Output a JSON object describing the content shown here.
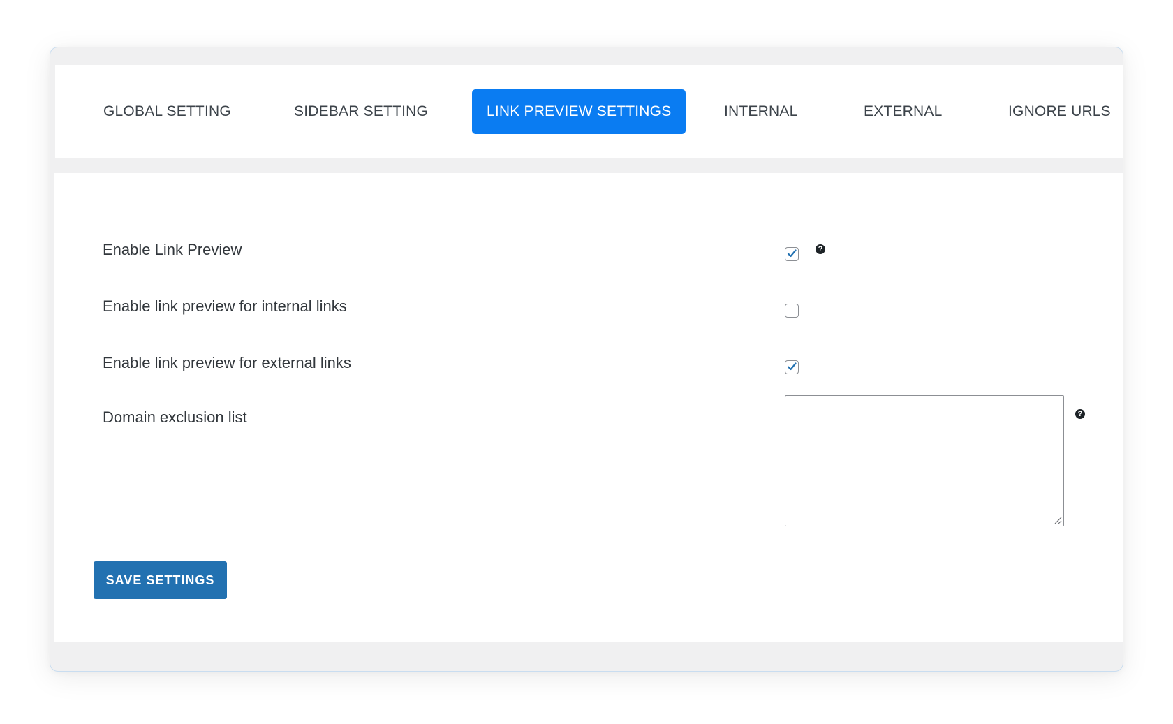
{
  "tabs": [
    {
      "label": "GLOBAL SETTING",
      "active": false
    },
    {
      "label": "SIDEBAR SETTING",
      "active": false
    },
    {
      "label": "LINK PREVIEW SETTINGS",
      "active": true
    },
    {
      "label": "INTERNAL",
      "active": false
    },
    {
      "label": "EXTERNAL",
      "active": false
    },
    {
      "label": "IGNORE URLS",
      "active": false
    }
  ],
  "settings": {
    "enable_link_preview": {
      "label": "Enable Link Preview",
      "checked": true,
      "help_icon": "question-circle-icon"
    },
    "internal_links": {
      "label": "Enable link preview for internal links",
      "checked": false
    },
    "external_links": {
      "label": "Enable link preview for external links",
      "checked": true
    },
    "domain_exclusion": {
      "label": "Domain exclusion list",
      "value": "",
      "help_icon": "question-circle-icon"
    }
  },
  "save_button": {
    "label": "SAVE SETTINGS"
  },
  "colors": {
    "active_tab": "#0a7cf2",
    "save_button": "#2271b1",
    "checkmark": "#2271b1",
    "frame_background": "#f0f0f1"
  },
  "help_glyph": "?"
}
